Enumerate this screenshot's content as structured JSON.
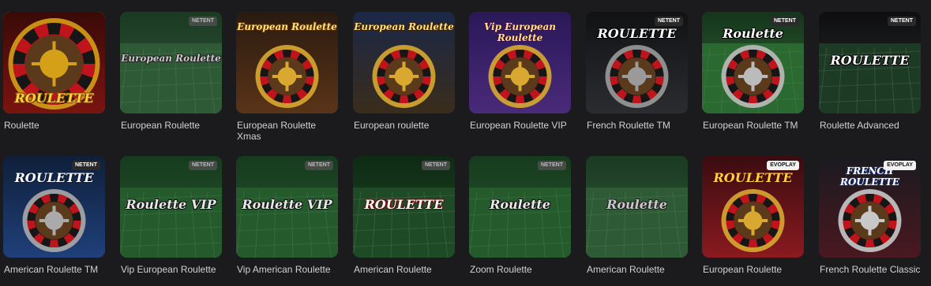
{
  "games": [
    {
      "title": "Roulette",
      "icon": "roulette-wheel-icon",
      "provider": "",
      "art": "ROULETTE",
      "theme": "red"
    },
    {
      "title": "European Roulette",
      "icon": "table-felt-icon",
      "provider": "NETENT",
      "art": "European Roulette",
      "theme": "green-blur"
    },
    {
      "title": "European Roulette Xmas",
      "icon": "roulette-wheel-icon",
      "provider": "",
      "art": "European Roulette",
      "theme": "wheel-gold"
    },
    {
      "title": "European roulette",
      "icon": "roulette-wheel-icon",
      "provider": "",
      "art": "European Roulette",
      "theme": "wheel-blue"
    },
    {
      "title": "European Roulette VIP",
      "icon": "roulette-wheel-icon",
      "provider": "",
      "art": "Vip European Roulette",
      "theme": "wheel-purple"
    },
    {
      "title": "French Roulette TM",
      "icon": "roulette-wheel-icon",
      "provider": "NETENT",
      "art": "ROULETTE",
      "theme": "dark-wheel"
    },
    {
      "title": "European Roulette TM",
      "icon": "roulette-wheel-icon",
      "provider": "NETENT",
      "art": "Roulette",
      "theme": "green-wheel"
    },
    {
      "title": "Roulette Advanced",
      "icon": "roulette-wheel-icon",
      "provider": "NETENT",
      "art": "ROULETTE",
      "theme": "dark-table"
    },
    {
      "title": "American Roulette TM",
      "icon": "roulette-wheel-icon",
      "provider": "NETENT",
      "art": "ROULETTE",
      "theme": "blue-wheel"
    },
    {
      "title": "Vip European Roulette",
      "icon": "table-felt-icon",
      "provider": "NETENT",
      "art": "Roulette VIP",
      "theme": "green"
    },
    {
      "title": "Vip American Roulette",
      "icon": "table-felt-icon",
      "provider": "NETENT",
      "art": "Roulette VIP",
      "theme": "green"
    },
    {
      "title": "American Roulette",
      "icon": "table-felt-icon",
      "provider": "NETENT",
      "art": "ROULETTE",
      "theme": "green-dark"
    },
    {
      "title": "Zoom Roulette",
      "icon": "table-felt-icon",
      "provider": "NETENT",
      "art": "Roulette",
      "theme": "green"
    },
    {
      "title": "American Roulette",
      "icon": "table-felt-icon",
      "provider": "",
      "art": "Roulette",
      "theme": "green-blur"
    },
    {
      "title": "European Roulette",
      "icon": "roulette-wheel-icon",
      "provider": "EVOPLAY",
      "art": "ROULETTE",
      "theme": "evo-red"
    },
    {
      "title": "French Roulette Classic",
      "icon": "roulette-wheel-icon",
      "provider": "EVOPLAY",
      "art": "FRENCH ROULETTE",
      "theme": "evo-french"
    }
  ],
  "colors": {
    "background": "#1b1b1d",
    "title": "#d2d2d2",
    "selected_border": "#e0b400",
    "felt_green": "#1f5a2b",
    "wheel_red": "#b3121a"
  }
}
